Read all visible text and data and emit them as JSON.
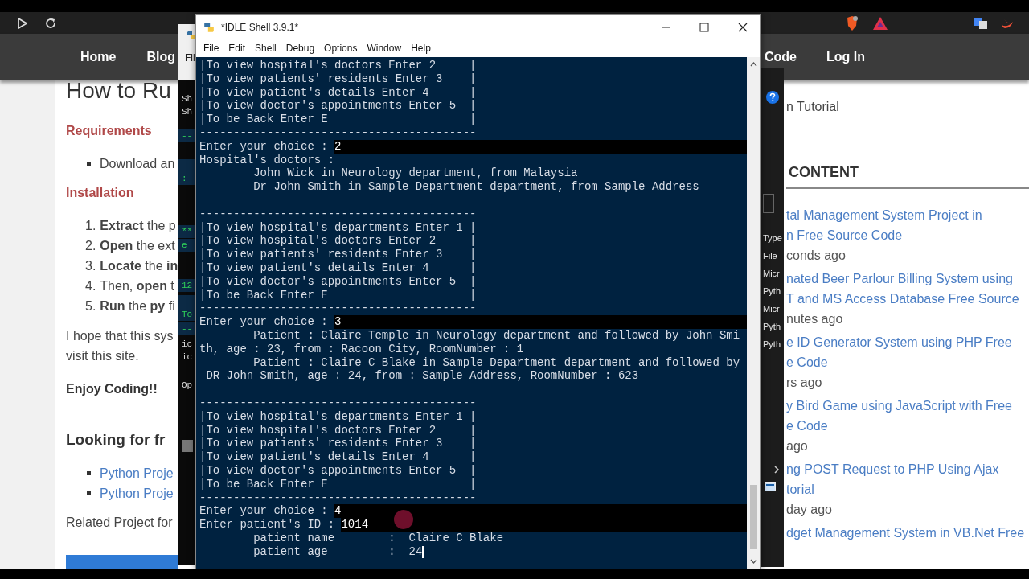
{
  "browser": {
    "nav_left": [
      {
        "label": "Home"
      },
      {
        "label": "Blog"
      }
    ],
    "nav_right": [
      {
        "label": "Code"
      },
      {
        "label": "Log In"
      }
    ]
  },
  "article": {
    "heading": "How to Ru",
    "requirements": {
      "title": "Requirements",
      "items": [
        "Download an"
      ]
    },
    "installation": {
      "title": "Installation",
      "steps": [
        {
          "number": "1.",
          "text": "**Extract** the p"
        },
        {
          "number": "2.",
          "text": "**Open** the ext"
        },
        {
          "number": "3.",
          "text": "**Locate** the **in**"
        },
        {
          "number": "4.",
          "text": "Then, **open** t"
        },
        {
          "number": "5.",
          "text": "**Run** the **py** fi"
        }
      ]
    },
    "paragraph": [
      "I hope that this sys",
      "visit this site."
    ],
    "closing": "Enjoy Coding!!",
    "more_heading": "Looking for fr",
    "links": [
      "Python Proje",
      "Python Proje"
    ],
    "related": "Related Project for"
  },
  "sidebar": {
    "intro": "n Tutorial",
    "heading": "CONTENT",
    "posts": [
      {
        "title_lines": [
          "tal Management System Project in",
          "n Free Source Code"
        ],
        "time": "conds ago"
      },
      {
        "title_lines": [
          "nated Beer Parlour Billing System using",
          "T and MS Access Database Free Source"
        ],
        "time": "nutes ago"
      },
      {
        "title_lines": [
          "e ID Generator System using PHP Free",
          "e Code"
        ],
        "time": "rs ago"
      },
      {
        "title_lines": [
          "y Bird Game using JavaScript with Free",
          "e Code"
        ],
        "time": "ago"
      },
      {
        "title_lines": [
          "ng POST Request to PHP Using Ajax",
          "torial"
        ],
        "time": "day ago"
      },
      {
        "title_lines": [
          "dget Management System in VB.Net Free"
        ]
      }
    ]
  },
  "left_window": {
    "menu_text": "Fil",
    "lines": [
      {
        "text": "Sh",
        "kind": "plain"
      },
      {
        "text": "Sh",
        "kind": "plain"
      },
      {
        "text": "--",
        "kind": "code"
      },
      {
        "text": "--",
        "kind": "code"
      },
      {
        "text": ":",
        "kind": "code"
      },
      {
        "text": "**",
        "kind": "code"
      },
      {
        "text": "e",
        "kind": "code"
      },
      {
        "text": "12",
        "kind": "code"
      },
      {
        "text": "--",
        "kind": "code"
      },
      {
        "text": "To",
        "kind": "code"
      },
      {
        "text": "--",
        "kind": "code"
      },
      {
        "text": "ic",
        "kind": "plain"
      },
      {
        "text": "ic",
        "kind": "plain"
      },
      {
        "text": "Op",
        "kind": "plain"
      }
    ]
  },
  "right_window": {
    "items": [
      "Type",
      "File",
      "Micr",
      "Pyth",
      "Micr",
      "Pyth",
      "Pyth"
    ]
  },
  "idle": {
    "title": "*IDLE Shell 3.9.1*",
    "menu": [
      "File",
      "Edit",
      "Shell",
      "Debug",
      "Options",
      "Window",
      "Help"
    ],
    "lines": [
      {
        "kind": "out",
        "text": "|To view hospital's doctors Enter 2     |"
      },
      {
        "kind": "out",
        "text": "|To view patients' residents Enter 3    |"
      },
      {
        "kind": "out",
        "text": "|To view patient's details Enter 4      |"
      },
      {
        "kind": "out",
        "text": "|To view doctor's appointments Enter 5  |"
      },
      {
        "kind": "out",
        "text": "|To be Back Enter E                     |"
      },
      {
        "kind": "out",
        "text": "-----------------------------------------"
      },
      {
        "kind": "in",
        "prompt": "Enter your choice : ",
        "entry": "2"
      },
      {
        "kind": "out",
        "text": "Hospital's doctors :"
      },
      {
        "kind": "out",
        "text": "        John Wick in Neurology department, from Malaysia"
      },
      {
        "kind": "out",
        "text": "        Dr John Smith in Sample Department department, from Sample Address"
      },
      {
        "kind": "blank"
      },
      {
        "kind": "out",
        "text": "-----------------------------------------"
      },
      {
        "kind": "out",
        "text": "|To view hospital's departments Enter 1 |"
      },
      {
        "kind": "out",
        "text": "|To view hospital's doctors Enter 2     |"
      },
      {
        "kind": "out",
        "text": "|To view patients' residents Enter 3    |"
      },
      {
        "kind": "out",
        "text": "|To view patient's details Enter 4      |"
      },
      {
        "kind": "out",
        "text": "|To view doctor's appointments Enter 5  |"
      },
      {
        "kind": "out",
        "text": "|To be Back Enter E                     |"
      },
      {
        "kind": "out",
        "text": "-----------------------------------------"
      },
      {
        "kind": "in",
        "prompt": "Enter your choice : ",
        "entry": "3"
      },
      {
        "kind": "out",
        "text": "        Patient : Claire Temple in Neurology department and followed by John Smi"
      },
      {
        "kind": "out",
        "text": "th, age : 23, from : Racoon City, RoomNumber : 1"
      },
      {
        "kind": "out",
        "text": "        Patient : Claire C Blake in Sample Department department and followed by"
      },
      {
        "kind": "out",
        "text": " DR John Smith, age : 24, from : Sample Address, RoomNumber : 623"
      },
      {
        "kind": "blank"
      },
      {
        "kind": "out",
        "text": "-----------------------------------------"
      },
      {
        "kind": "out",
        "text": "|To view hospital's departments Enter 1 |"
      },
      {
        "kind": "out",
        "text": "|To view hospital's doctors Enter 2     |"
      },
      {
        "kind": "out",
        "text": "|To view patients' residents Enter 3    |"
      },
      {
        "kind": "out",
        "text": "|To view patient's details Enter 4      |"
      },
      {
        "kind": "out",
        "text": "|To view doctor's appointments Enter 5  |"
      },
      {
        "kind": "out",
        "text": "|To be Back Enter E                     |"
      },
      {
        "kind": "out",
        "text": "-----------------------------------------"
      },
      {
        "kind": "in",
        "prompt": "Enter your choice : ",
        "entry": "4"
      },
      {
        "kind": "in",
        "prompt": "Enter patient's ID : ",
        "entry": "1014"
      },
      {
        "kind": "out",
        "text": "        patient name        :  Claire C Blake"
      },
      {
        "kind": "active",
        "text": "        patient age         :  24"
      }
    ]
  }
}
